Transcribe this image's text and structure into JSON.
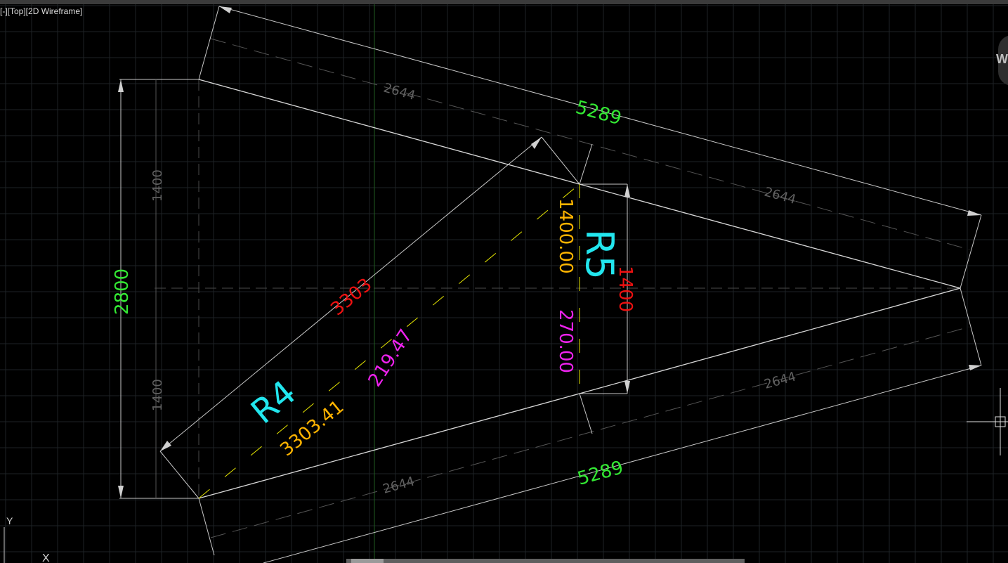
{
  "viewport": {
    "label": "[-][Top][2D Wireframe]"
  },
  "navwheel": {
    "letter": "W"
  },
  "ucs": {
    "y_label": "Y",
    "x_label": "X"
  },
  "colors": {
    "background": "#000000",
    "grid": "#1e2226",
    "line": "#c8c8c8",
    "dim_gray": "#6e6e6e",
    "green": "#33e833",
    "red": "#ee1111",
    "cyan": "#22e6ee",
    "orange": "#ffb400",
    "magenta": "#ee22ee",
    "yellow": "#e6e600"
  },
  "dimensions": {
    "top_length": "5289",
    "bottom_length": "5289",
    "left_height": "2800",
    "left_half_upper": "1400",
    "left_half_lower": "1400",
    "diag_red": "3303",
    "right_red": "1400",
    "segment_upper_left": "2644",
    "segment_upper_right": "2644",
    "segment_lower_right": "2644",
    "segment_lower_left": "2644"
  },
  "labels": {
    "r4": "R4",
    "r5": "R5",
    "r4_length": "3303.41",
    "r4_offset": "219.47",
    "r5_length": "1400.00",
    "r5_offset": "270.00"
  }
}
